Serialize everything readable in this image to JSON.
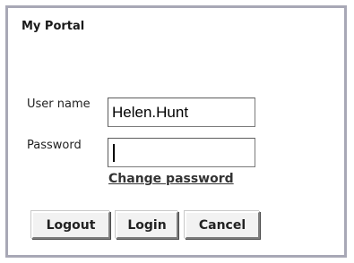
{
  "portal": {
    "title": "My Portal",
    "username_label": "User name",
    "username_value": "Helen.Hunt",
    "password_label": "Password",
    "password_value": "",
    "change_password_link": "Change password",
    "buttons": {
      "logout": "Logout",
      "login": "Login",
      "cancel": "Cancel"
    }
  },
  "colors": {
    "frame_border": "#a8a8b6",
    "text": "#222222",
    "background": "#ffffff"
  }
}
